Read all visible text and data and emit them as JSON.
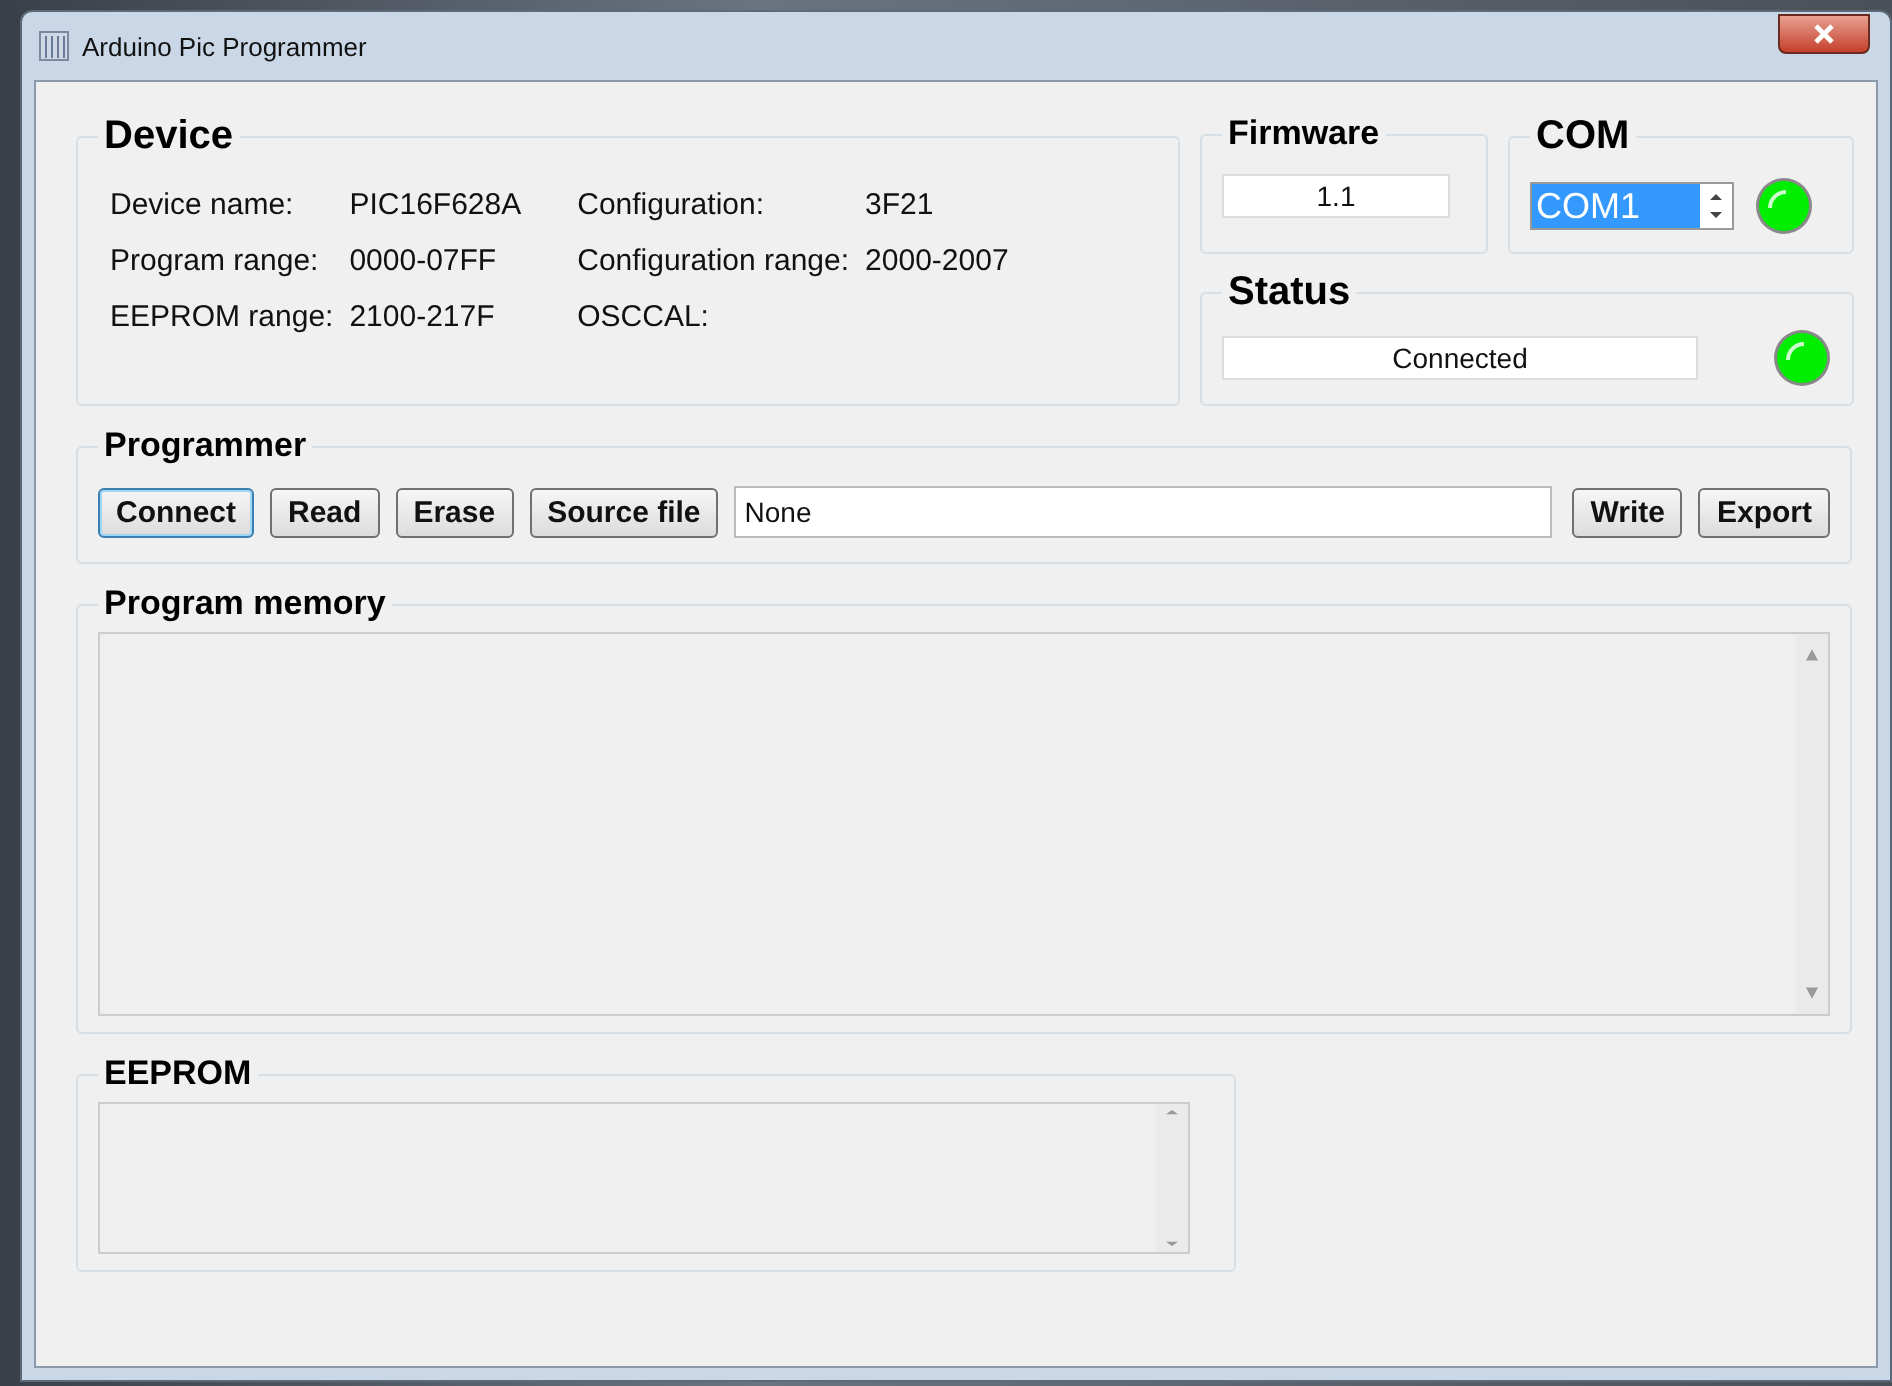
{
  "window": {
    "title": "Arduino Pic Programmer"
  },
  "device": {
    "title": "Device",
    "fields": [
      {
        "label": "Device name:",
        "value": "PIC16F628A"
      },
      {
        "label": "Configuration:",
        "value": "3F21"
      },
      {
        "label": "Program range:",
        "value": "0000-07FF"
      },
      {
        "label": "Configuration range:",
        "value": "2000-2007"
      },
      {
        "label": "EEPROM range:",
        "value": "2100-217F"
      },
      {
        "label": "OSCCAL:"
      }
    ]
  },
  "firmware": {
    "title": "Firmware",
    "value": "1.1"
  },
  "com": {
    "title": "COM",
    "value": "COM1",
    "highlighted": true,
    "led_on": true
  },
  "status": {
    "title": "Status",
    "value": "Connected",
    "led_on": true
  },
  "programmer": {
    "title": "Programmer",
    "buttons": [
      {
        "label": "Connect",
        "focused": true
      },
      {
        "label": "Read",
        "focused": false
      },
      {
        "label": "Erase",
        "focused": false
      },
      {
        "label": "Source file",
        "focused": false
      }
    ],
    "file": "None",
    "buttons_after": [
      {
        "label": "Write",
        "focused": false
      },
      {
        "label": "Export",
        "focused": false
      }
    ]
  },
  "program_memory": {
    "title": "Program memory"
  },
  "eeprom": {
    "title": "EEPROM"
  }
}
